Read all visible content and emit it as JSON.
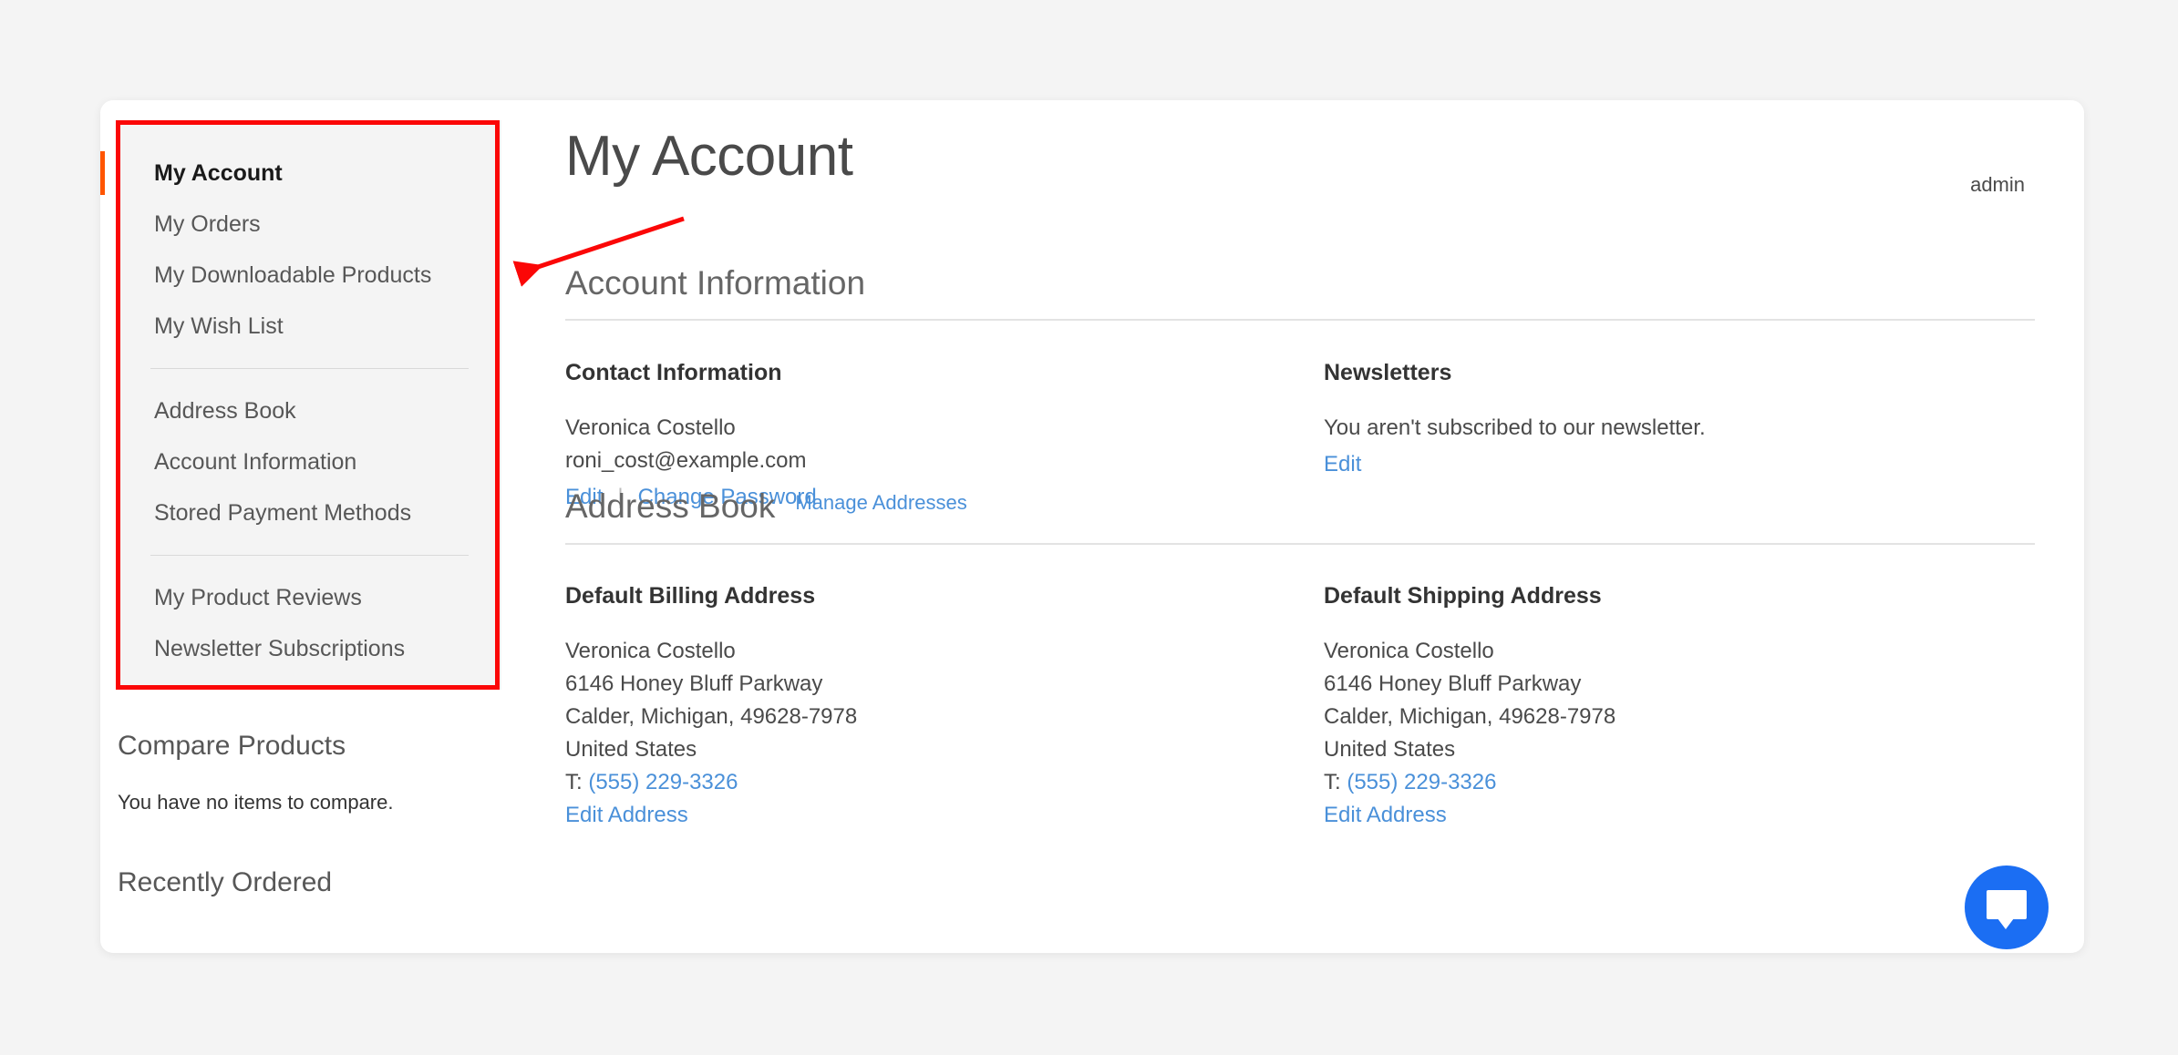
{
  "header": {
    "page_title": "My Account",
    "user_label": "admin"
  },
  "sidebar": {
    "nav_groups": [
      {
        "items": [
          {
            "label": "My Account",
            "current": true
          },
          {
            "label": "My Orders",
            "current": false
          },
          {
            "label": "My Downloadable Products",
            "current": false
          },
          {
            "label": "My Wish List",
            "current": false
          }
        ]
      },
      {
        "items": [
          {
            "label": "Address Book",
            "current": false
          },
          {
            "label": "Account Information",
            "current": false
          },
          {
            "label": "Stored Payment Methods",
            "current": false
          }
        ]
      },
      {
        "items": [
          {
            "label": "My Product Reviews",
            "current": false
          },
          {
            "label": "Newsletter Subscriptions",
            "current": false
          }
        ]
      }
    ],
    "compare_products": {
      "title": "Compare Products",
      "empty_text": "You have no items to compare."
    },
    "recently_ordered": {
      "title": "Recently Ordered"
    }
  },
  "main": {
    "account_information": {
      "section_title": "Account Information",
      "contact": {
        "heading": "Contact Information",
        "name": "Veronica Costello",
        "email": "roni_cost@example.com",
        "edit_label": "Edit",
        "separator": "|",
        "change_password_label": "Change Password"
      },
      "newsletters": {
        "heading": "Newsletters",
        "status_text": "You aren't subscribed to our newsletter.",
        "edit_label": "Edit"
      }
    },
    "address_book": {
      "section_title": "Address Book",
      "manage_link_label": "Manage Addresses",
      "billing": {
        "heading": "Default Billing Address",
        "name": "Veronica Costello",
        "street": "6146 Honey Bluff Parkway",
        "city_region_postcode": "Calder, Michigan, 49628-7978",
        "country": "United States",
        "phone_prefix": "T:",
        "phone": "(555) 229-3326",
        "edit_label": "Edit Address"
      },
      "shipping": {
        "heading": "Default Shipping Address",
        "name": "Veronica Costello",
        "street": "6146 Honey Bluff Parkway",
        "city_region_postcode": "Calder, Michigan, 49628-7978",
        "country": "United States",
        "phone_prefix": "T:",
        "phone": "(555) 229-3326",
        "edit_label": "Edit Address"
      }
    }
  },
  "chat_widget": {
    "icon": "chat-bubble-icon"
  },
  "annotation": {
    "highlight_color": "#fb0707",
    "arrow_color": "#fb0707"
  },
  "colors": {
    "accent_orange": "#ff5501",
    "link_blue": "#4a90d9",
    "chat_blue": "#1b6ef3",
    "page_background": "#f4f4f4",
    "sidebar_panel": "#f4f4f4"
  }
}
